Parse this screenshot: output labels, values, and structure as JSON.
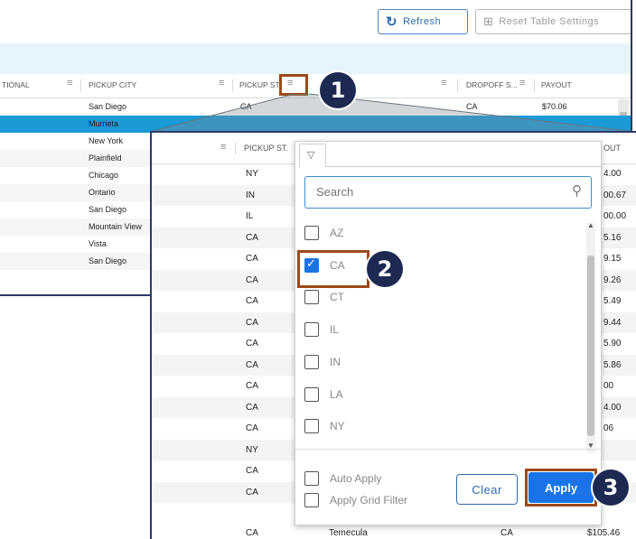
{
  "toolbar": {
    "refresh_label": "Refresh",
    "reset_label": "Reset Table Settings"
  },
  "bg_table": {
    "headers": [
      "TIONAL",
      "PICKUP CITY",
      "PICKUP ST",
      "DROPOFF S...",
      "PAYOUT"
    ],
    "rows": [
      {
        "city": "San Diego",
        "state": "CA",
        "dropoff": "CA",
        "payout": "$70.06"
      },
      {
        "city": "Murrieta",
        "state": "",
        "dropoff": "",
        "payout": ""
      },
      {
        "city": "New York",
        "state": "",
        "dropoff": "",
        "payout": ""
      },
      {
        "city": "Plainfield",
        "state": "",
        "dropoff": "",
        "payout": ""
      },
      {
        "city": "Chicago",
        "state": "",
        "dropoff": "",
        "payout": ""
      },
      {
        "city": "Ontario",
        "state": "",
        "dropoff": "",
        "payout": ""
      },
      {
        "city": "San Diego",
        "state": "",
        "dropoff": "",
        "payout": ""
      },
      {
        "city": "Mountain View",
        "state": "",
        "dropoff": "",
        "payout": ""
      },
      {
        "city": "Vista",
        "state": "",
        "dropoff": "",
        "payout": ""
      },
      {
        "city": "San Diego",
        "state": "",
        "dropoff": "",
        "payout": ""
      }
    ]
  },
  "fg_table": {
    "header_state": "PICKUP ST.",
    "header_payout": "OUT",
    "rows": [
      {
        "state": "NY",
        "payout": "4.00"
      },
      {
        "state": "IN",
        "payout": "00.67"
      },
      {
        "state": "IL",
        "payout": "00.00"
      },
      {
        "state": "CA",
        "payout": "5.16"
      },
      {
        "state": "CA",
        "payout": "9.15"
      },
      {
        "state": "CA",
        "payout": "9.26"
      },
      {
        "state": "CA",
        "payout": "5.49"
      },
      {
        "state": "CA",
        "payout": "9.44"
      },
      {
        "state": "CA",
        "payout": "5.90"
      },
      {
        "state": "CA",
        "payout": "5.86"
      },
      {
        "state": "CA",
        "payout": "00"
      },
      {
        "state": "CA",
        "payout": "4.00"
      },
      {
        "state": "CA",
        "payout": "06"
      },
      {
        "state": "NY",
        "payout": ""
      },
      {
        "state": "CA",
        "payout": ""
      },
      {
        "state": "CA",
        "payout": ""
      }
    ],
    "last_row": {
      "state": "CA",
      "city": "Temecula",
      "dropoff": "CA",
      "payout": "$105.46"
    }
  },
  "filter": {
    "search_placeholder": "Search",
    "options": [
      {
        "label": "AZ",
        "checked": false
      },
      {
        "label": "CA",
        "checked": true
      },
      {
        "label": "CT",
        "checked": false
      },
      {
        "label": "IL",
        "checked": false
      },
      {
        "label": "IN",
        "checked": false
      },
      {
        "label": "LA",
        "checked": false
      },
      {
        "label": "NY",
        "checked": false
      }
    ],
    "auto_apply_label": "Auto Apply",
    "grid_filter_label": "Apply Grid Filter",
    "clear_label": "Clear",
    "apply_label": "Apply"
  },
  "callouts": [
    "1",
    "2",
    "3"
  ],
  "colors": {
    "accent": "#1a73e8",
    "selected_row": "#1a9ad6",
    "callout": "#1d2951",
    "highlight": "#9c4a18"
  }
}
